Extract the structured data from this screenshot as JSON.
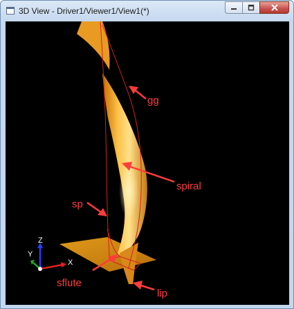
{
  "window": {
    "title": "3D View - Driver1/Viewer1/View1(*)",
    "icon": "window-icon",
    "controls": {
      "minimize": "minimize-icon",
      "maximize": "maximize-icon",
      "close": "close-icon"
    }
  },
  "viewport": {
    "background": "#000000",
    "surface_color": "#f5a623",
    "curve_color": "#d42020",
    "annotation_color": "#ff3b3b",
    "annotations": {
      "gg": "gg",
      "spiral": "spiral",
      "sp": "sp",
      "sflute": "sflute",
      "lip": "lip"
    },
    "axes": {
      "x": "X",
      "y": "Y",
      "z": "Z"
    }
  }
}
